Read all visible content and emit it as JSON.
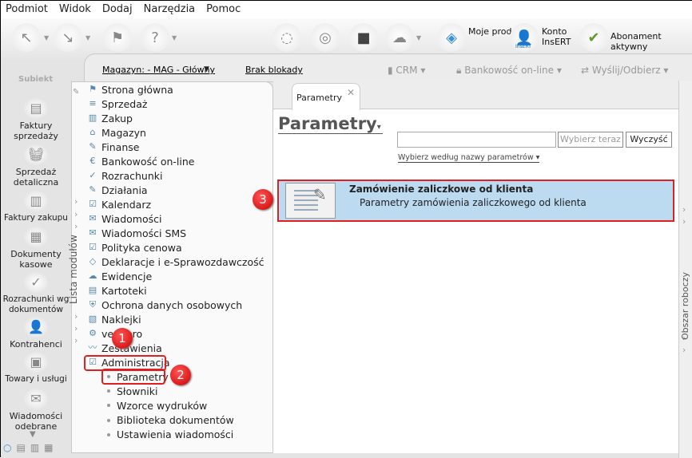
{
  "menu": [
    "Podmiot",
    "Widok",
    "Dodaj",
    "Narzędzia",
    "Pomoc"
  ],
  "toolbar": {
    "moje_produkty": "Moje produkty",
    "konto_insert": "Konto InsERT",
    "insert_logo": "InsERT",
    "abonament": "Abonament aktywny"
  },
  "header": {
    "brand": "Subiekt",
    "magazyn": "Magazyn: - MAG - Główny",
    "brak_blokady": "Brak blokady",
    "crm": "CRM",
    "bankowosc": "Bankowość on-line",
    "wyslij": "Wyślij/Odbierz"
  },
  "leftnav": [
    "Faktury sprzedaży",
    "Sprzedaż detaliczna",
    "Faktury zakupu",
    "Dokumenty kasowe",
    "Rozrachunki wg dokumentów",
    "Kontrahenci",
    "Towary i usługi",
    "Wiadomości odebrane"
  ],
  "modules": {
    "label": "Lista modułów",
    "items": [
      "Strona główna",
      "Sprzedaż",
      "Zakup",
      "Magazyn",
      "Finanse",
      "Bankowość on-line",
      "Rozrachunki",
      "Działania",
      "Kalendarz",
      "Wiadomości",
      "Wiadomości SMS",
      "Polityka cenowa",
      "Deklaracje i e-Sprawozdawczość",
      "Ewidencje",
      "Kartoteki",
      "Ochrona danych osobowych",
      "Naklejki",
      "vendero",
      "Zestawienia",
      "Administracja"
    ],
    "subitems": [
      "Parametry",
      "Słowniki",
      "Wzorce wydruków",
      "Biblioteka dokumentów",
      "Ustawienia wiadomości"
    ]
  },
  "badges": [
    "1",
    "2",
    "3"
  ],
  "main": {
    "tab": "Parametry",
    "title": "Parametry",
    "search_value": "",
    "select_now": "Wybierz teraz",
    "clear": "Wyczyść",
    "sort_by": "Wybierz według nazwy parametrów",
    "items": [
      {
        "title": "Zamówienie zaliczkowe od klienta",
        "desc": "Parametry zamówienia zaliczkowego od klienta",
        "selected": true
      }
    ]
  },
  "workspace_label": "Obszar roboczy",
  "colors": {
    "selection": "#bcdaf0",
    "highlight": "#e02020",
    "shield": "#5aa02c"
  }
}
